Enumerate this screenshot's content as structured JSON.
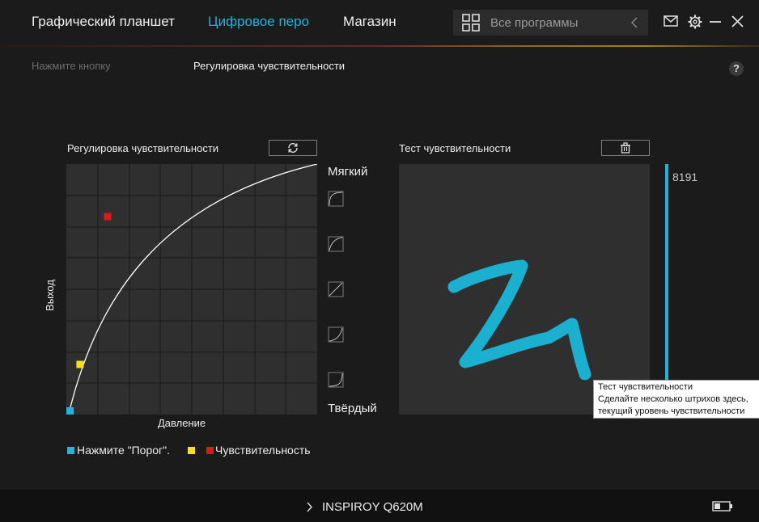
{
  "header": {
    "tabs": [
      {
        "label": "Графический планшет",
        "active": false
      },
      {
        "label": "Цифровое перо",
        "active": true
      },
      {
        "label": "Магазин",
        "active": false
      }
    ],
    "search": {
      "placeholder": "Все программы",
      "icon": "grid-icon"
    },
    "window_icons": [
      "mail-icon",
      "gear-icon",
      "minimize-icon",
      "close-icon"
    ]
  },
  "subtabs": [
    {
      "label": "Нажмите кнопку",
      "active": false
    },
    {
      "label": "Регулировка чувствительности",
      "active": true
    }
  ],
  "help_label": "?",
  "curve_panel": {
    "title": "Регулировка чувствительности",
    "reset_icon": "refresh-icon",
    "xlabel": "Давление",
    "ylabel": "Выход",
    "soft_label": "Мягкий",
    "hard_label": "Твёрдый",
    "presets": [
      "preset-soft-2-icon",
      "preset-soft-1-icon",
      "preset-linear-icon",
      "preset-hard-1-icon",
      "preset-hard-2-icon"
    ],
    "points": {
      "threshold": {
        "pressure": 0.0,
        "output": 0.0,
        "color": "#27b2d8"
      },
      "yellow": {
        "pressure": 0.04,
        "output": 0.2,
        "color": "#f5e11b"
      },
      "sensitivity": {
        "pressure": 0.15,
        "output": 0.79,
        "color": "#e0181d"
      }
    }
  },
  "legend": {
    "items": [
      {
        "label": "Нажмите \"Порог\".",
        "color": "#27b2d8"
      },
      {
        "label": "",
        "color": "#f5e11b"
      },
      {
        "label": "Чувствительность",
        "color": "#e0181d"
      }
    ]
  },
  "test_panel": {
    "title": "Тест чувствительности",
    "clear_icon": "trash-icon",
    "max_pressure": "8191",
    "pressure_level": 1.0,
    "stroke_color": "#1bb0d0"
  },
  "tooltip": {
    "title": "Тест чувствительности",
    "line1": "Сделайте несколько штрихов здесь,",
    "line2": "текущий уровень чувствительности"
  },
  "footer": {
    "device": "INSPIROY Q620M",
    "battery_icon": "battery-icon"
  },
  "colors": {
    "accent": "#27b2d8",
    "background": "#1b1b1b",
    "panel": "#2f2f2f"
  }
}
